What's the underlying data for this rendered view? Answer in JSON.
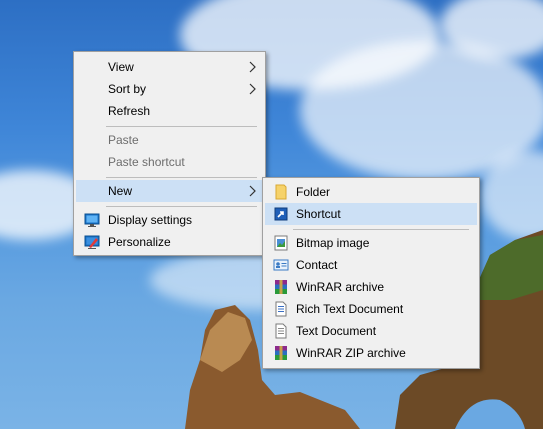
{
  "context_menu": {
    "items": [
      {
        "label": "View"
      },
      {
        "label": "Sort by"
      },
      {
        "label": "Refresh"
      },
      {
        "label": "Paste"
      },
      {
        "label": "Paste shortcut"
      },
      {
        "label": "New"
      },
      {
        "label": "Display settings"
      },
      {
        "label": "Personalize"
      }
    ]
  },
  "new_submenu": {
    "items": [
      {
        "label": "Folder"
      },
      {
        "label": "Shortcut"
      },
      {
        "label": "Bitmap image"
      },
      {
        "label": "Contact"
      },
      {
        "label": "WinRAR archive"
      },
      {
        "label": "Rich Text Document"
      },
      {
        "label": "Text Document"
      },
      {
        "label": "WinRAR ZIP archive"
      }
    ]
  },
  "colors": {
    "menu_background": "#f0f0f0",
    "hover_highlight": "#cce0f5",
    "disabled_text": "#6d6d6d"
  }
}
